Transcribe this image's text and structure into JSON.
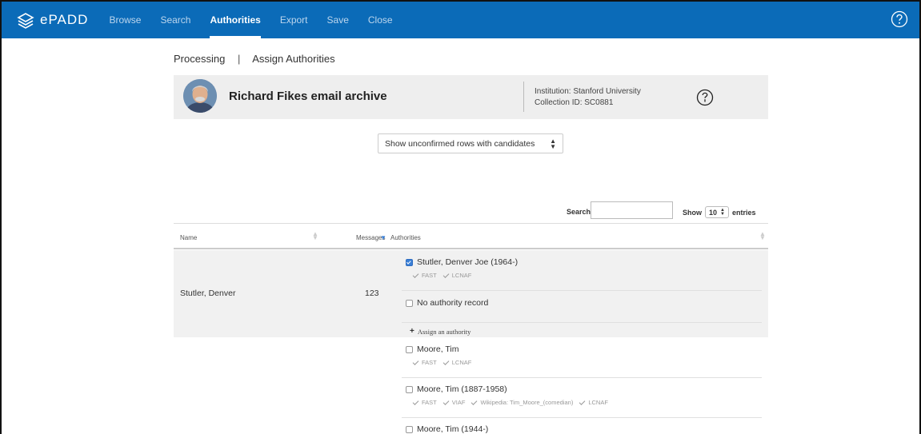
{
  "nav": {
    "logo_text": "ePADD",
    "items": [
      {
        "label": "Browse",
        "active": false
      },
      {
        "label": "Search",
        "active": false
      },
      {
        "label": "Authorities",
        "active": true
      },
      {
        "label": "Export",
        "active": false
      },
      {
        "label": "Save",
        "active": false
      },
      {
        "label": "Close",
        "active": false
      }
    ],
    "help_icon": "question-circle-icon",
    "colors": {
      "bar": "#0b6bb8",
      "active": "#ffffff",
      "inactive": "#bcd6ee"
    }
  },
  "breadcrumb": {
    "items": [
      "Processing",
      "Assign Authorities"
    ],
    "separator": "|"
  },
  "header": {
    "title": "Richard Fikes email archive",
    "institution": "Institution: Stanford University",
    "collection_id": "Collection ID: SC0881",
    "avatar": "portrait-photo",
    "info_icon": "info-circle-icon"
  },
  "filter": {
    "selected": "Show unconfirmed rows with candidates"
  },
  "table_controls": {
    "search_label": "Search:",
    "search_value": "",
    "show_label": "Show",
    "entries_value": "10",
    "entries_label": "entries"
  },
  "table": {
    "columns": [
      "Name",
      "Messages",
      "Authorities"
    ],
    "rows": [
      {
        "name": "Stutler, Denver",
        "messages": "123",
        "candidates": [
          {
            "label": "Stutler, Denver Joe (1964-)",
            "checked": true,
            "sources": [
              "FAST",
              "LCNAF"
            ]
          },
          {
            "label": "No authority record",
            "checked": false,
            "sources": []
          }
        ],
        "assign_label": "Assign an authority"
      },
      {
        "name": "",
        "messages": "",
        "candidates": [
          {
            "label": "Moore, Tim",
            "checked": false,
            "sources": [
              "FAST",
              "LCNAF"
            ]
          },
          {
            "label": "Moore, Tim (1887-1958)",
            "checked": false,
            "sources": [
              "FAST",
              "VIAF",
              "Wikipedia: Tim_Moore_(comedian)",
              "LCNAF"
            ]
          },
          {
            "label": "Moore, Tim (1944-)",
            "checked": false,
            "sources": []
          }
        ]
      }
    ]
  }
}
